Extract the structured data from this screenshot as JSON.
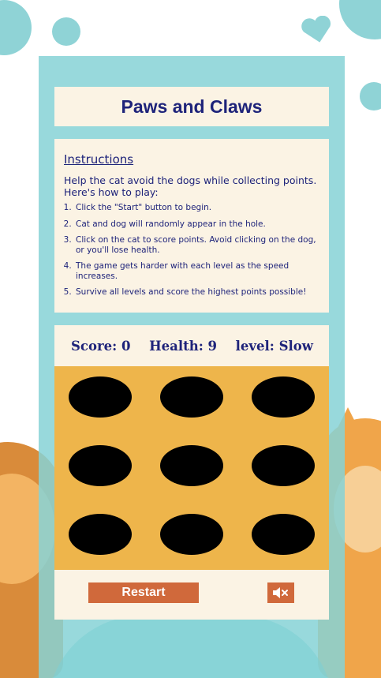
{
  "game": {
    "title": "Paws and Claws"
  },
  "instructions": {
    "heading": "Instructions",
    "intro": "Help the cat avoid the dogs while collecting points. Here's how to play:",
    "steps": [
      "Click the \"Start\" button to begin.",
      "Cat and dog will randomly appear in the hole.",
      "Click on the cat to score points. Avoid clicking on the dog, or you'll lose health.",
      "The game gets harder with each level as the speed increases.",
      "Survive all levels and score the highest points possible!"
    ]
  },
  "stats": {
    "score": "Score: 0",
    "health": "Health: 9",
    "level": "level: Slow"
  },
  "board": {
    "rows": 3,
    "columns": 3
  },
  "controls": {
    "restart_label": "Restart",
    "mute_icon": "speaker-muted-icon"
  },
  "colors": {
    "panel": "#86d2d6",
    "card": "#fbf3e4",
    "text": "#1e237a",
    "board": "#eeb54b",
    "hole": "#000000",
    "button": "#d0693b"
  }
}
